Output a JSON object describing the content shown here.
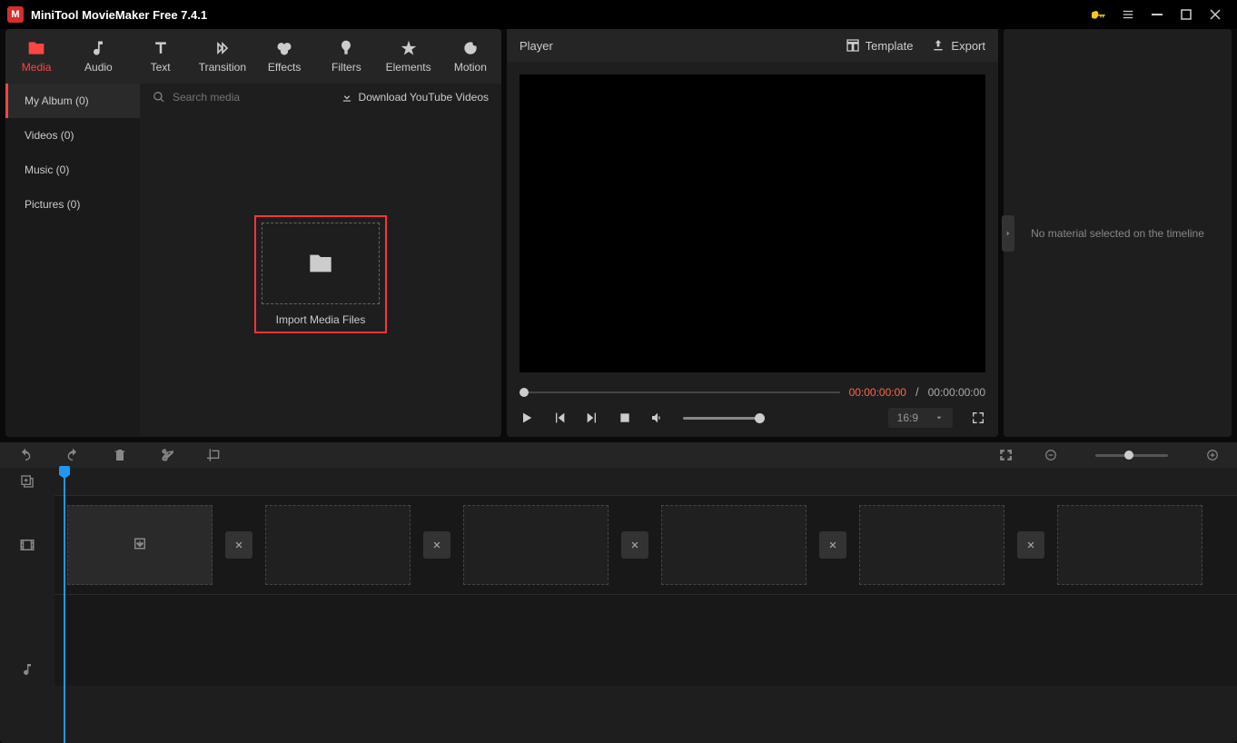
{
  "app": {
    "title": "MiniTool MovieMaker Free 7.4.1"
  },
  "toolbar": [
    {
      "name": "media",
      "label": "Media"
    },
    {
      "name": "audio",
      "label": "Audio"
    },
    {
      "name": "text",
      "label": "Text"
    },
    {
      "name": "transition",
      "label": "Transition"
    },
    {
      "name": "effects",
      "label": "Effects"
    },
    {
      "name": "filters",
      "label": "Filters"
    },
    {
      "name": "elements",
      "label": "Elements"
    },
    {
      "name": "motion",
      "label": "Motion"
    }
  ],
  "sideTabs": [
    {
      "label": "My Album (0)"
    },
    {
      "label": "Videos (0)"
    },
    {
      "label": "Music (0)"
    },
    {
      "label": "Pictures (0)"
    }
  ],
  "search": {
    "placeholder": "Search media"
  },
  "download": {
    "label": "Download YouTube Videos"
  },
  "import": {
    "label": "Import Media Files"
  },
  "player": {
    "title": "Player",
    "template": "Template",
    "export": "Export",
    "timeCurrent": "00:00:00:00",
    "timeSep": "/",
    "timeTotal": "00:00:00:00",
    "aspect": "16:9"
  },
  "rightPanel": {
    "message": "No material selected on the timeline"
  }
}
